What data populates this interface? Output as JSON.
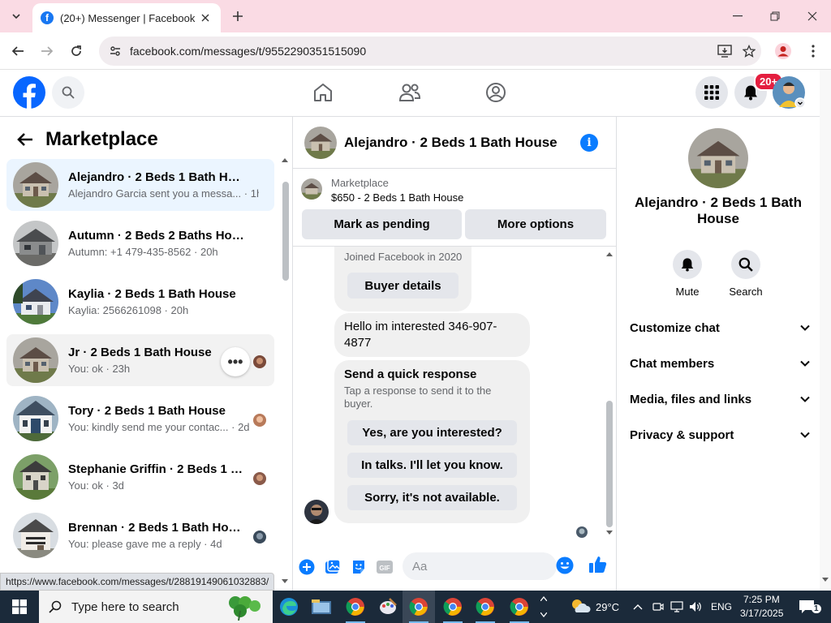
{
  "browser": {
    "tab_title": "(20+) Messenger | Facebook",
    "url": "facebook.com/messages/t/9552290351515090",
    "status_url": "https://www.facebook.com/messages/t/28819149061032883/"
  },
  "fb_header": {
    "notification_badge": "20+"
  },
  "marketplace": {
    "title": "Marketplace",
    "chats": [
      {
        "name": "Alejandro · 2 Beds 1 Bath House",
        "snippet": "Alejandro Garcia sent you a messa... · 1h"
      },
      {
        "name": "Autumn · 2 Beds 2 Baths House",
        "snippet": "Autumn: +1 479-435-8562 · 20h"
      },
      {
        "name": "Kaylia · 2 Beds 1 Bath House",
        "snippet": "Kaylia: 2566261098 · 20h"
      },
      {
        "name": "Jr · 2 Beds 1 Bath House",
        "snippet": "You: ok · 23h"
      },
      {
        "name": "Tory · 2 Beds 1 Bath House",
        "snippet": "You: kindly send me your contac... · 2d"
      },
      {
        "name": "Stephanie Griffin · 2 Beds 1 Ba...",
        "snippet": "You: ok · 3d"
      },
      {
        "name": "Brennan · 2 Beds 1 Bath House",
        "snippet": "You: please gave me a reply · 4d"
      }
    ],
    "more_label": "•••"
  },
  "conversation": {
    "title": "Alejandro · 2 Beds 1 Bath House",
    "listing_label": "Marketplace",
    "listing_price": "$650 - 2 Beds 1 Bath House",
    "mark_pending": "Mark as pending",
    "more_options": "More options",
    "joined": "Joined Facebook in 2020",
    "buyer_details": "Buyer details",
    "message_line1": "Hello im interested 346-907-",
    "message_line2": "4877",
    "quick_title": "Send a quick response",
    "quick_sub_line1": "Tap a response to send it to the",
    "quick_sub_line2": "buyer.",
    "quick_responses": [
      "Yes, are you interested?",
      "In talks. I'll let you know.",
      "Sorry, it's not available."
    ],
    "composer_placeholder": "Aa"
  },
  "details": {
    "title": "Alejandro · 2 Beds 1 Bath House",
    "mute": "Mute",
    "search": "Search",
    "sections": [
      "Customize chat",
      "Chat members",
      "Media, files and links",
      "Privacy & support"
    ]
  },
  "taskbar": {
    "search_placeholder": "Type here to search",
    "temperature": "29°C",
    "language": "ENG",
    "time": "7:25 PM",
    "date": "3/17/2025",
    "notification_count": "1"
  },
  "colors": {
    "facebook_blue": "#0866ff",
    "messenger_blue": "#0a7cff",
    "active_chat_bg": "#ebf5ff",
    "tab_strip": "#fadbe4",
    "taskbar": "#1b2a3a"
  }
}
